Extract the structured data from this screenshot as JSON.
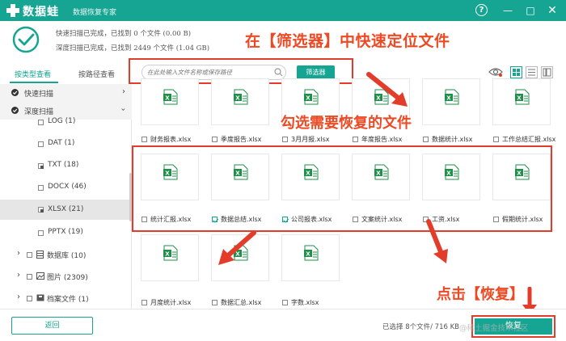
{
  "titlebar": {
    "app_name": "数据蛙",
    "app_subtitle": "数据恢复专家",
    "help_label": "?",
    "minimize_label": "—",
    "maximize_label": "□",
    "close_label": "✕"
  },
  "status": {
    "quick_scan_text": "快速扫描已完成，已找到 0 个文件 (0.00 B)",
    "deep_scan_text": "深度扫描已完成，已找到 2449 个文件 (1.04 GB)"
  },
  "annotations": {
    "filter_hint": "在【筛选器】中快速定位文件",
    "select_hint": "勾选需要恢复的文件",
    "recover_hint": "点击【恢复】"
  },
  "tabs": [
    {
      "label": "按类型查看"
    },
    {
      "label": "按路径查看"
    }
  ],
  "search": {
    "placeholder": "在此处输入文件名称或保存路径"
  },
  "filter_button": "筛选器",
  "sidebar": {
    "quick_scan": "快速扫描",
    "deep_scan": "深度扫描",
    "types": [
      {
        "label": "LOG (1)"
      },
      {
        "label": "DAT (1)"
      },
      {
        "label": "TXT (18)"
      },
      {
        "label": "DOCX (46)"
      },
      {
        "label": "XLSX (21)"
      },
      {
        "label": "PPTX (19)"
      }
    ],
    "groups": [
      {
        "label": "数据库 (10)"
      },
      {
        "label": "图片 (2309)"
      },
      {
        "label": "档案文件 (1)"
      }
    ]
  },
  "files": {
    "row1": [
      {
        "name": "财务报表.xlsx",
        "checked": false
      },
      {
        "name": "季度报告.xlsx",
        "checked": false
      },
      {
        "name": "3月月报.xlsx",
        "checked": false
      },
      {
        "name": "年度报告.xlsx",
        "checked": false
      },
      {
        "name": "数据统计.xlsx",
        "checked": false
      },
      {
        "name": "工作总结汇报.xlsx",
        "checked": false
      }
    ],
    "row2": [
      {
        "name": "统计汇报.xlsx",
        "checked": false
      },
      {
        "name": "数据总结.xlsx",
        "checked": true
      },
      {
        "name": "公司报表.xlsx",
        "checked": true
      },
      {
        "name": "文案统计.xlsx",
        "checked": false
      },
      {
        "name": "工资.xlsx",
        "checked": false
      },
      {
        "name": "假期统计.xlsx",
        "checked": false
      }
    ],
    "row3": [
      {
        "name": "月度统计.xlsx",
        "checked": false
      },
      {
        "name": "数据汇总.xlsx",
        "checked": false
      },
      {
        "name": "字数.xlsx",
        "checked": false
      }
    ]
  },
  "footer": {
    "back_label": "返回",
    "summary_text": "已选择 8个文件/ 716 KB",
    "recover_label": "恢复",
    "watermark": "@稀土掘金技术社区"
  },
  "colors": {
    "brand": "#16a592",
    "annotation": "#ec4a24",
    "highlight_border": "#e43c2a"
  }
}
